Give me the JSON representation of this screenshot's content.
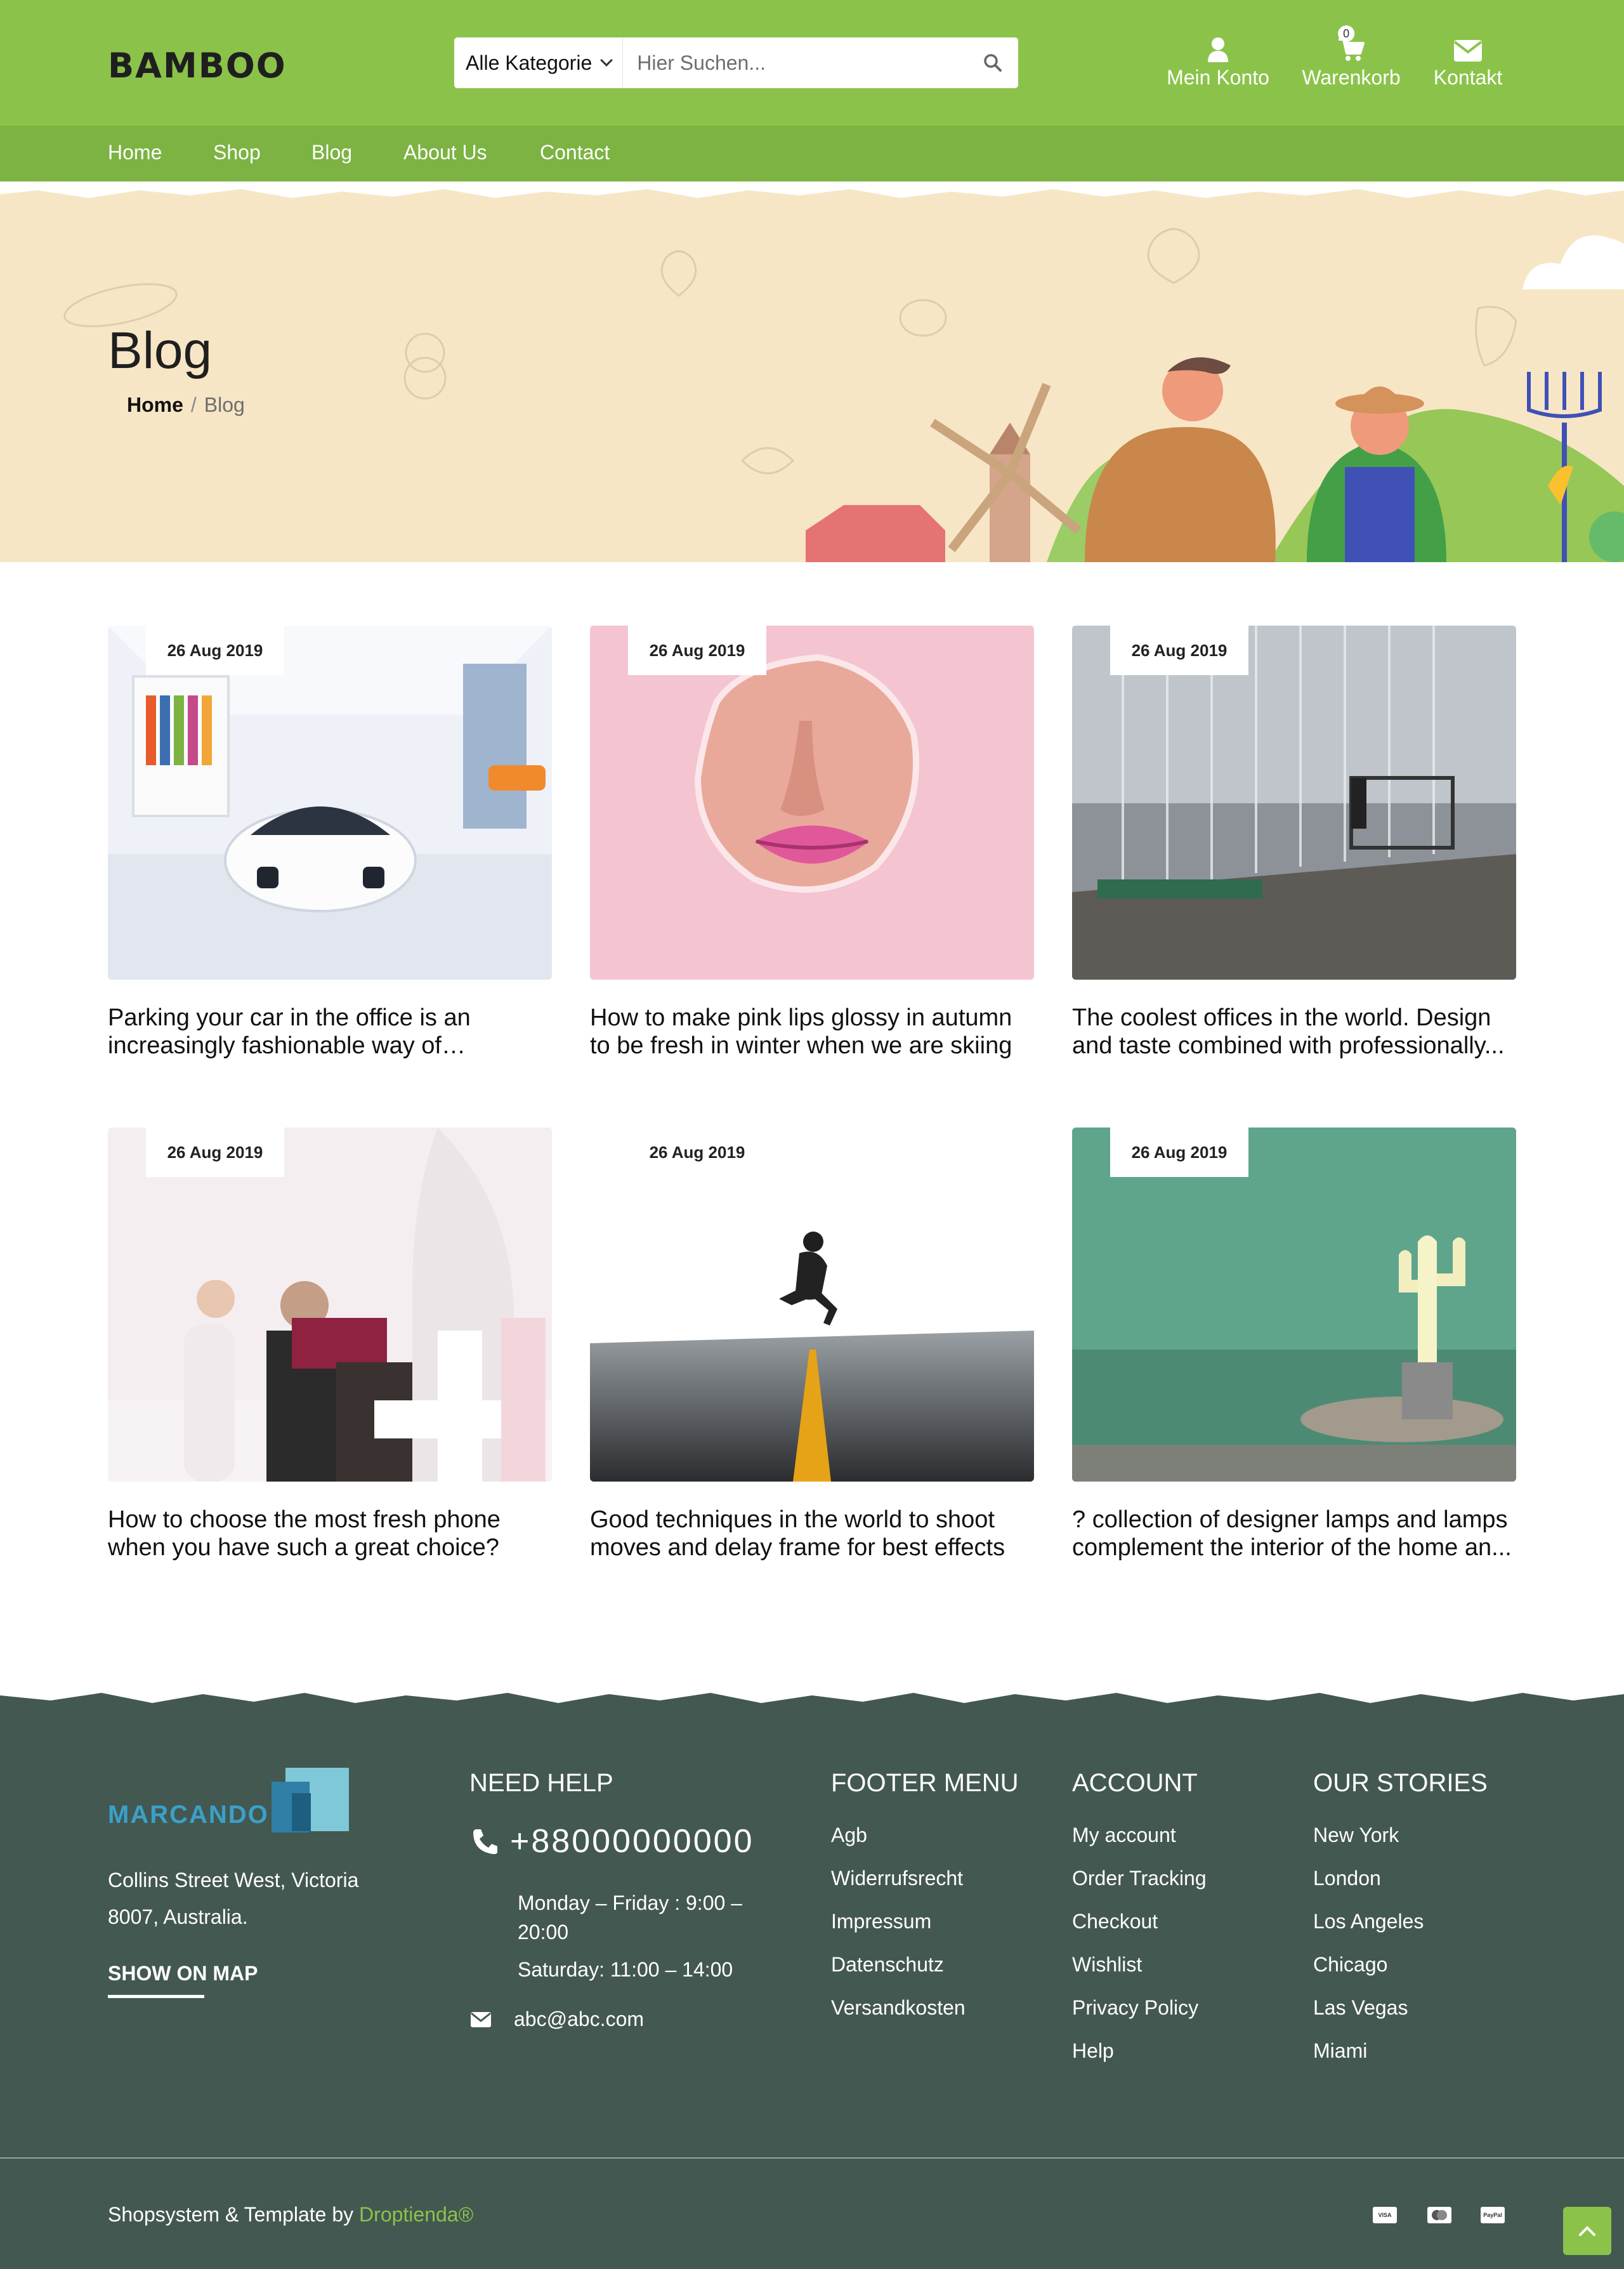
{
  "header": {
    "logo": "BAMBOO",
    "search": {
      "category": "Alle Kategorie",
      "placeholder": "Hier Suchen..."
    },
    "account_label": "Mein Konto",
    "cart_label": "Warenkorb",
    "cart_count": "0",
    "contact_label": "Kontakt",
    "brand_color": "#8bc34a"
  },
  "nav": {
    "items": [
      "Home",
      "Shop",
      "Blog",
      "About Us",
      "Contact"
    ]
  },
  "hero": {
    "title": "Blog",
    "breadcrumb_home": "Home",
    "breadcrumb_sep": "/",
    "breadcrumb_current": "Blog"
  },
  "posts": [
    {
      "date": "26 Aug 2019",
      "title": "Parking your car in the office is an increasingly fashionable way of enjoying..."
    },
    {
      "date": "26 Aug 2019",
      "title": "How to make pink lips glossy in autumn to be fresh in winter when we are skiing"
    },
    {
      "date": "26 Aug 2019",
      "title": "The coolest offices in the world. Design and taste combined with professionally..."
    },
    {
      "date": "26 Aug 2019",
      "title": "How to choose the most fresh phone when you have such a great choice?"
    },
    {
      "date": "26 Aug 2019",
      "title": "Good techniques in the world to shoot moves and delay frame for best effects"
    },
    {
      "date": "26 Aug 2019",
      "title": "? collection of designer lamps and lamps complement the interior of the home an..."
    }
  ],
  "footer": {
    "logo_text": "MARCANDO",
    "address": "Collins Street West, Victoria 8007, Australia.",
    "map_link": "SHOW ON MAP",
    "help": {
      "heading": "NEED HELP",
      "phone": "+88000000000",
      "hours_weekday": "Monday – Friday : 9:00 – 20:00",
      "hours_saturday": "Saturday: 11:00 – 14:00",
      "email": "abc@abc.com"
    },
    "menu": {
      "heading": "FOOTER MENU",
      "items": [
        "Agb",
        "Widerrufsrecht",
        "Impressum",
        "Datenschutz",
        "Versandkosten"
      ]
    },
    "account": {
      "heading": "ACCOUNT",
      "items": [
        "My account",
        "Order Tracking",
        "Checkout",
        "Wishlist",
        "Privacy Policy",
        "Help"
      ]
    },
    "stories": {
      "heading": "OUR STORIES",
      "items": [
        "New York",
        "London",
        "Los Angeles",
        "Chicago",
        "Las Vegas",
        "Miami"
      ]
    },
    "copyright_prefix": "Shopsystem & Template by ",
    "copyright_brand": "Droptienda®",
    "payments": [
      "VISA",
      "mastercard",
      "PayPal"
    ],
    "bg_color": "#435850"
  }
}
